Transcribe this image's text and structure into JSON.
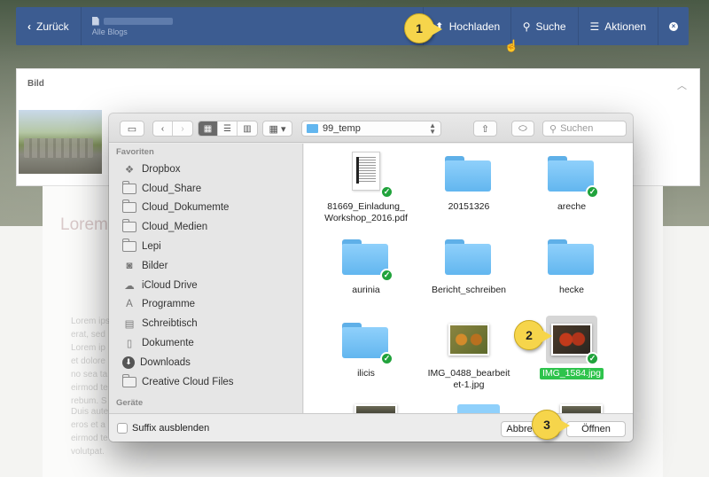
{
  "topbar": {
    "back_label": "Zurück",
    "subtitle": "Alle Blogs",
    "upload_label": "Hochladen",
    "search_label": "Suche",
    "actions_label": "Aktionen"
  },
  "card": {
    "title": "Bild"
  },
  "page_text": {
    "block1": "Lorem",
    "block2": "Lorem ipsum\nerat, sed\nLorem ip\net dolore\nno sea ta\neirmod te\nrebum. S",
    "block3": "Duis aute\neros et a\neirmod te\nvolutpat."
  },
  "dialog": {
    "location": "99_temp",
    "search_placeholder": "Suchen",
    "sidebar": {
      "favorites_header": "Favoriten",
      "devices_header": "Geräte",
      "items": [
        {
          "label": "Dropbox",
          "icon": "dropbox-icon"
        },
        {
          "label": "Cloud_Share",
          "icon": "folder-icon"
        },
        {
          "label": "Cloud_Dokumemte",
          "icon": "folder-icon"
        },
        {
          "label": "Cloud_Medien",
          "icon": "folder-icon"
        },
        {
          "label": "Lepi",
          "icon": "folder-icon"
        },
        {
          "label": "Bilder",
          "icon": "camera-icon"
        },
        {
          "label": "iCloud Drive",
          "icon": "cloud-icon"
        },
        {
          "label": "Programme",
          "icon": "apps-icon"
        },
        {
          "label": "Schreibtisch",
          "icon": "desktop-icon"
        },
        {
          "label": "Dokumente",
          "icon": "documents-icon"
        },
        {
          "label": "Downloads",
          "icon": "download-icon"
        },
        {
          "label": "Creative Cloud Files",
          "icon": "folder-icon"
        }
      ]
    },
    "files": [
      {
        "name": "81669_Einladung_\nWorkshop_2016.pdf",
        "kind": "pdf",
        "synced": true
      },
      {
        "name": "20151326",
        "kind": "folder",
        "synced": false
      },
      {
        "name": "areche",
        "kind": "folder",
        "synced": true
      },
      {
        "name": "aurinia",
        "kind": "folder",
        "synced": true
      },
      {
        "name": "Bericht_schreiben",
        "kind": "folder",
        "synced": false
      },
      {
        "name": "hecke",
        "kind": "folder",
        "synced": false
      },
      {
        "name": "ilicis",
        "kind": "folder",
        "synced": true
      },
      {
        "name": "IMG_0488_bearbeit\net-1.jpg",
        "kind": "image",
        "synced": false
      },
      {
        "name": "IMG_1584.jpg",
        "kind": "image",
        "synced": true,
        "selected": true
      }
    ],
    "hide_suffix_label": "Suffix ausblenden",
    "cancel_label": "Abbrechen",
    "open_label": "Öffnen"
  },
  "callouts": [
    "1",
    "2",
    "3"
  ],
  "colors": {
    "topbar": "#3c5c91",
    "callout": "#f6d54b",
    "selection": "#2ec34c",
    "folder": "#62b6ef",
    "sync_check": "#21a33c"
  }
}
